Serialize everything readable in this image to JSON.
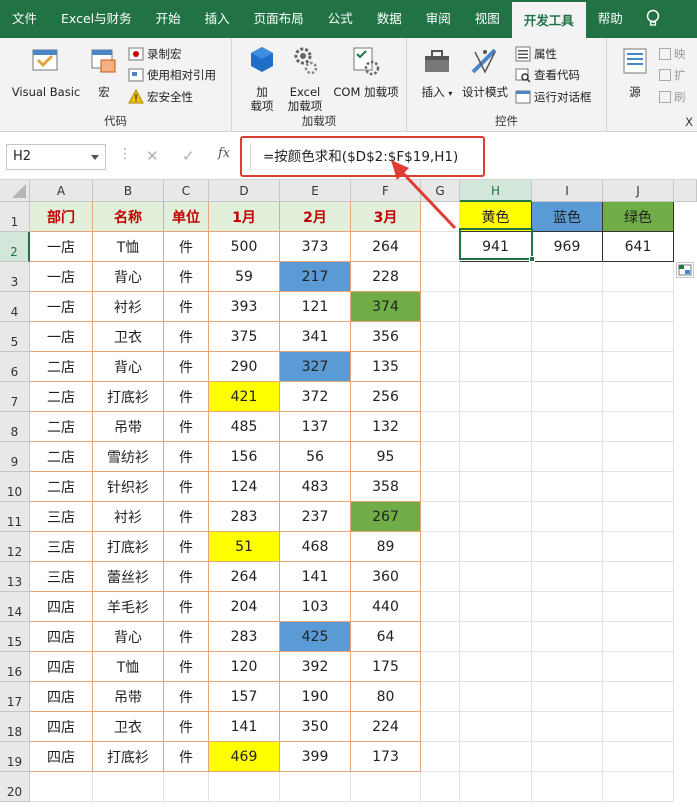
{
  "menu": {
    "items": [
      "文件",
      "Excel与财务",
      "开始",
      "插入",
      "页面布局",
      "公式",
      "数据",
      "审阅",
      "视图",
      "开发工具",
      "帮助"
    ],
    "active": "开发工具",
    "lightbulb_icon": "lightbulb-icon"
  },
  "ribbon": {
    "code": {
      "label": "代码",
      "visual_basic": "Visual Basic",
      "macros": "宏",
      "record_macro": "录制宏",
      "relative_ref": "使用相对引用",
      "macro_security": "宏安全性"
    },
    "addins": {
      "label": "加载项",
      "addins_line1": "加",
      "addins_line2": "载项",
      "excel_addins_line1": "Excel",
      "excel_addins_line2": "加载项",
      "com_addins": "COM 加载项"
    },
    "controls": {
      "label": "控件",
      "insert": "插入",
      "design_mode": "设计模式",
      "properties": "属性",
      "view_code": "查看代码",
      "run_dialog": "运行对话框"
    },
    "xml": {
      "label": "X",
      "source": "源",
      "map": "映",
      "expand": "扩",
      "refresh": "刷"
    }
  },
  "formula_bar": {
    "name_box": "H2",
    "fx": "fx",
    "formula": "=按颜色求和($D$2:$F$19,H1)"
  },
  "columns": [
    "A",
    "B",
    "C",
    "D",
    "E",
    "F",
    "G",
    "H",
    "I",
    "J"
  ],
  "rows": [
    "1",
    "2",
    "3",
    "4",
    "5",
    "6",
    "7",
    "8",
    "9",
    "10",
    "11",
    "12",
    "13",
    "14",
    "15",
    "16",
    "17",
    "18",
    "19",
    "20"
  ],
  "table": {
    "headers": [
      "部门",
      "名称",
      "单位",
      "1月",
      "2月",
      "3月"
    ],
    "data": [
      [
        "一店",
        "T恤",
        "件",
        "500",
        "373",
        "264"
      ],
      [
        "一店",
        "背心",
        "件",
        "59",
        "217",
        "228"
      ],
      [
        "一店",
        "衬衫",
        "件",
        "393",
        "121",
        "374"
      ],
      [
        "一店",
        "卫衣",
        "件",
        "375",
        "341",
        "356"
      ],
      [
        "二店",
        "背心",
        "件",
        "290",
        "327",
        "135"
      ],
      [
        "二店",
        "打底衫",
        "件",
        "421",
        "372",
        "256"
      ],
      [
        "二店",
        "吊带",
        "件",
        "485",
        "137",
        "132"
      ],
      [
        "二店",
        "雪纺衫",
        "件",
        "156",
        "56",
        "95"
      ],
      [
        "二店",
        "针织衫",
        "件",
        "124",
        "483",
        "358"
      ],
      [
        "三店",
        "衬衫",
        "件",
        "283",
        "237",
        "267"
      ],
      [
        "三店",
        "打底衫",
        "件",
        "51",
        "468",
        "89"
      ],
      [
        "三店",
        "蕾丝衫",
        "件",
        "264",
        "141",
        "360"
      ],
      [
        "四店",
        "羊毛衫",
        "件",
        "204",
        "103",
        "440"
      ],
      [
        "四店",
        "背心",
        "件",
        "283",
        "425",
        "64"
      ],
      [
        "四店",
        "T恤",
        "件",
        "120",
        "392",
        "175"
      ],
      [
        "四店",
        "吊带",
        "件",
        "157",
        "190",
        "80"
      ],
      [
        "四店",
        "卫衣",
        "件",
        "141",
        "350",
        "224"
      ],
      [
        "四店",
        "打底衫",
        "件",
        "469",
        "399",
        "173"
      ]
    ],
    "highlights": {
      "yellow": [
        [
          5,
          3
        ],
        [
          10,
          3
        ],
        [
          17,
          3
        ]
      ],
      "blue": [
        [
          1,
          4
        ],
        [
          4,
          4
        ],
        [
          13,
          4
        ]
      ],
      "green": [
        [
          2,
          5
        ],
        [
          9,
          5
        ]
      ]
    }
  },
  "result": {
    "headers": [
      "黄色",
      "蓝色",
      "绿色"
    ],
    "values": [
      "941",
      "969",
      "641"
    ]
  },
  "colors": {
    "excel_green": "#217346",
    "header_fill": "#e2efda",
    "header_text": "#c00000",
    "yellow": "#ffff00",
    "blue": "#5b9bd5",
    "green": "#70ad47",
    "annotation_red": "#e03c31"
  }
}
